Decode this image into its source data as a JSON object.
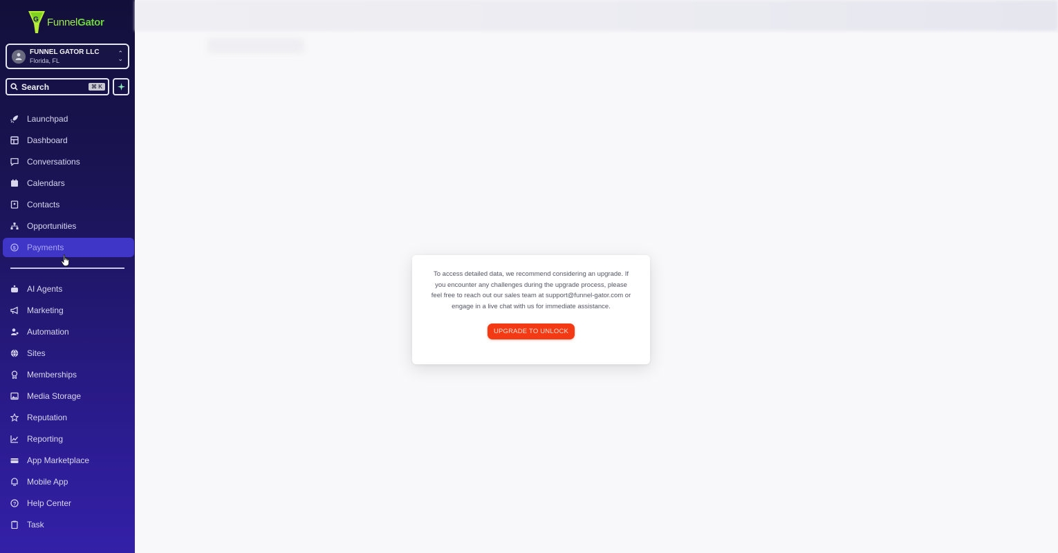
{
  "brand": {
    "logo_part1": "Funnel",
    "logo_part2": "Gator",
    "logo_color": "#6fd63a"
  },
  "account": {
    "name": "FUNNEL GATOR LLC",
    "location": "Florida, FL"
  },
  "search": {
    "label": "Search",
    "shortcut": "⌘ K"
  },
  "nav": {
    "items": [
      {
        "label": "Launchpad",
        "icon": "rocket-icon"
      },
      {
        "label": "Dashboard",
        "icon": "dashboard-icon"
      },
      {
        "label": "Conversations",
        "icon": "chat-icon"
      },
      {
        "label": "Calendars",
        "icon": "calendar-icon"
      },
      {
        "label": "Contacts",
        "icon": "contact-icon"
      },
      {
        "label": "Opportunities",
        "icon": "pipeline-icon"
      },
      {
        "label": "Payments",
        "icon": "dollar-icon",
        "active": true
      }
    ],
    "items2": [
      {
        "label": "AI Agents",
        "icon": "robot-icon"
      },
      {
        "label": "Marketing",
        "icon": "megaphone-icon"
      },
      {
        "label": "Automation",
        "icon": "automation-icon"
      },
      {
        "label": "Sites",
        "icon": "globe-icon"
      },
      {
        "label": "Memberships",
        "icon": "award-icon"
      },
      {
        "label": "Media Storage",
        "icon": "image-icon"
      },
      {
        "label": "Reputation",
        "icon": "star-icon"
      },
      {
        "label": "Reporting",
        "icon": "chart-icon"
      },
      {
        "label": "App Marketplace",
        "icon": "marketplace-icon"
      },
      {
        "label": "Mobile App",
        "icon": "mobile-icon"
      },
      {
        "label": "Help Center",
        "icon": "help-icon"
      },
      {
        "label": "Task",
        "icon": "clipboard-icon"
      }
    ]
  },
  "modal": {
    "message": "To access detailed data, we recommend considering an upgrade. If you encounter any challenges during the upgrade process, please feel free to reach out our sales team at support@funnel-gator.com or engage in a live chat with us for immediate assistance.",
    "button_label": "UPGRADE TO UNLOCK",
    "button_color": "#f43a14"
  },
  "colors": {
    "sidebar_top": "#120f3a",
    "sidebar_bottom": "#3320a8",
    "active_item": "#3f36c7"
  }
}
